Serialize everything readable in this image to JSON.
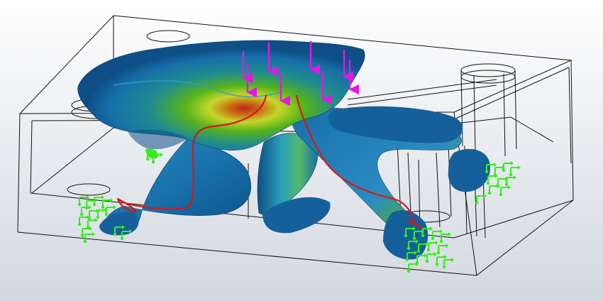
{
  "viewport": {
    "background_top": "#ffffff",
    "background_bottom": "#d2d8e0"
  },
  "colors": {
    "outline": "#111111",
    "body_dark": "#0d4f86",
    "body_mid": "#176fa8",
    "body_light": "#2a8cc2",
    "stress_green": "#56b31c",
    "stress_yellow": "#c6d62a",
    "stress_orange": "#c96e14",
    "stress_red": "#c2231a",
    "load_arrow": "#e614e6",
    "fixture": "#33ee1a",
    "load_path": "#d41818"
  },
  "icons": {
    "loads": "downward-force-arrows-icon",
    "fixtures": "fixed-geometry-support-icon"
  }
}
